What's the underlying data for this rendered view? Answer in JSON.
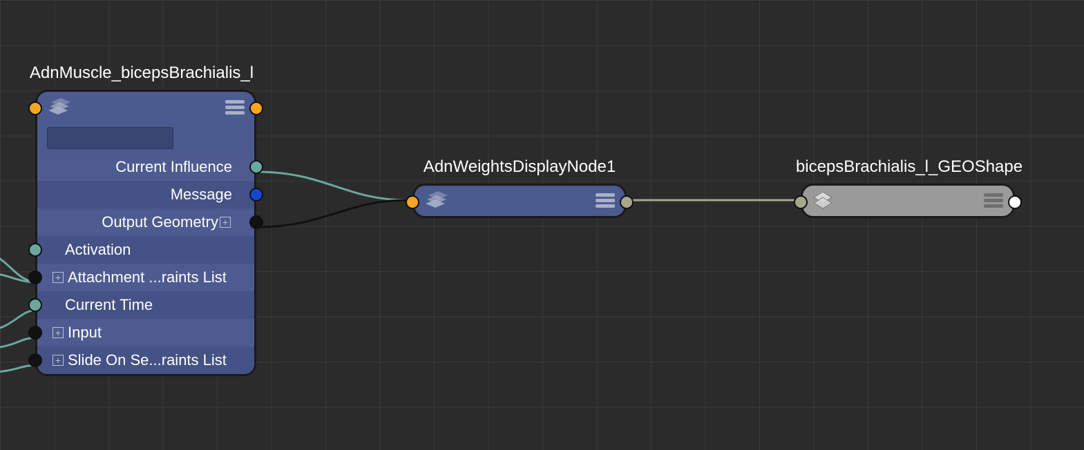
{
  "nodes": {
    "muscle": {
      "title": "AdnMuscle_bicepsBrachialis_l",
      "search_value": "",
      "attrs": {
        "current_influence": "Current Influence",
        "message": "Message",
        "output_geometry": "Output Geometry",
        "activation": "Activation",
        "attachment_list": "Attachment ...raints List",
        "current_time": "Current Time",
        "input": "Input",
        "slide_list": "Slide On Se...raints List"
      }
    },
    "weights": {
      "title": "AdnWeightsDisplayNode1"
    },
    "shape": {
      "title": "bicepsBrachialis_l_GEOShape"
    }
  },
  "colors": {
    "orange": "#f5a623",
    "teal": "#6aa89d",
    "olive": "#a7a78d"
  }
}
